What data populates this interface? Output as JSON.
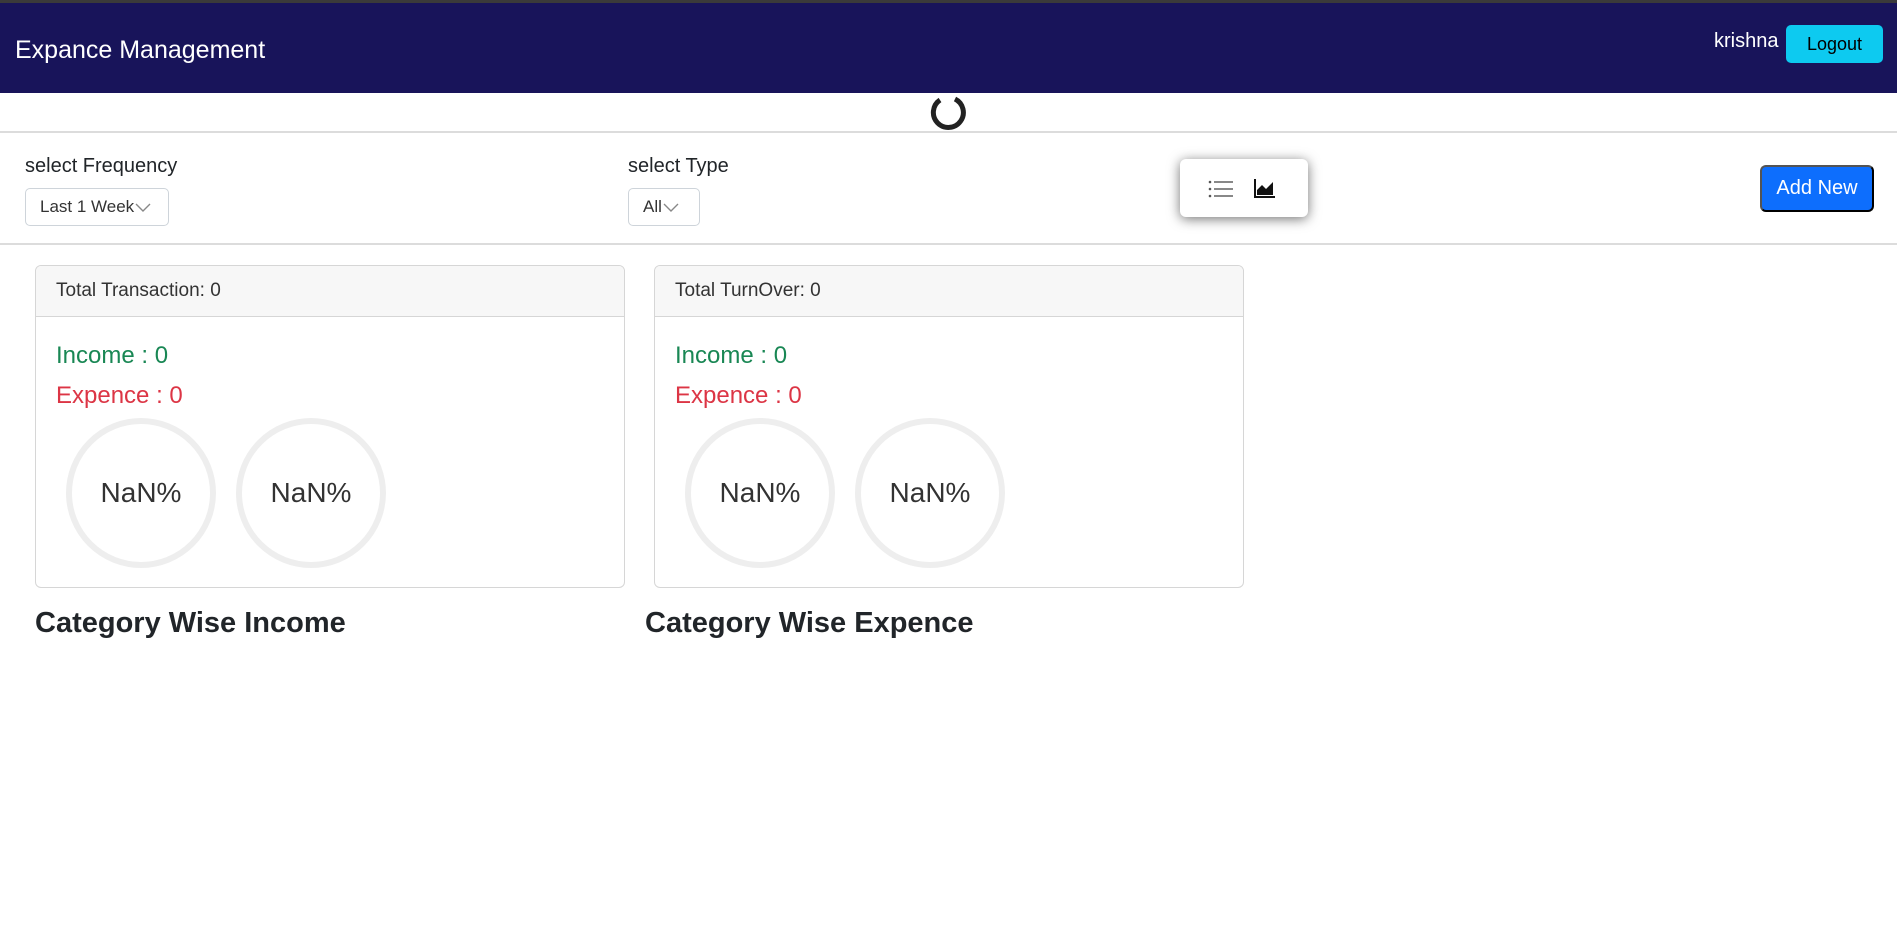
{
  "navbar": {
    "brand": "Expance Management",
    "username": "krishna",
    "logout_label": "Logout"
  },
  "filters": {
    "frequency_label": "select Frequency",
    "frequency_value": "Last 1 Week",
    "type_label": "select Type",
    "type_value": "All",
    "view_icons": [
      "list-icon",
      "area-chart-icon"
    ],
    "add_new_label": "Add New"
  },
  "cards": [
    {
      "header": "Total Transaction: 0",
      "income": "Income : 0",
      "expence": "Expence : 0",
      "circles": [
        "NaN%",
        "NaN%"
      ]
    },
    {
      "header": "Total TurnOver: 0",
      "income": "Income : 0",
      "expence": "Expence : 0",
      "circles": [
        "NaN%",
        "NaN%"
      ]
    }
  ],
  "sections": {
    "income_title": "Category Wise Income",
    "expence_title": "Category Wise Expence"
  },
  "colors": {
    "navbar": "#18145a",
    "logout": "#0dcaf0",
    "add_new": "#0d6efd",
    "income": "#198754",
    "expence": "#dc3545"
  }
}
